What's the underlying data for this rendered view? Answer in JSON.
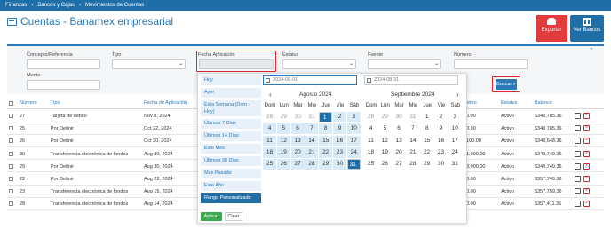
{
  "breadcrumb": [
    "Finanzas",
    "Bancos y Cajas",
    "Movimientos de Cuentas"
  ],
  "page_title": "Cuentas - Banamex empresarial",
  "buttons": {
    "exportar": "Exportar",
    "ver_bancos": "Ver Bancos",
    "buscar": "Buscar",
    "aplicar": "Aplicar",
    "clear": "Clear"
  },
  "filters": {
    "concepto_label": "Concepto/Referencia",
    "tipo_label": "Tipo",
    "fecha_label": "Fecha Aplicación",
    "estatus_label": "Estatus",
    "fuente_label": "Fuente",
    "numero_label": "Número",
    "monto_label": "Monto"
  },
  "date_range": {
    "options": [
      "Hoy",
      "Ayer",
      "Esta Semana (Dom - Hoy)",
      "Últimos 7 Días",
      "Últimos 14 Días",
      "Este Mes",
      "Últimos 30 Días",
      "Mes Pasado",
      "Este Año",
      "Rango Personalizado"
    ],
    "active": "Rango Personalizado",
    "start": "2024-08-01",
    "end": "2024-08-31",
    "weekdays": [
      "Dom",
      "Lun",
      "Mar",
      "Mie",
      "Jue",
      "Vie",
      "Sáb"
    ],
    "months": [
      {
        "name": "Agosto 2024",
        "days": [
          [
            "28",
            "29",
            "30",
            "31",
            "1",
            "2",
            "3"
          ],
          [
            "4",
            "5",
            "6",
            "7",
            "8",
            "9",
            "10"
          ],
          [
            "11",
            "12",
            "13",
            "14",
            "15",
            "16",
            "17"
          ],
          [
            "18",
            "19",
            "20",
            "21",
            "22",
            "23",
            "24"
          ],
          [
            "25",
            "26",
            "27",
            "28",
            "29",
            "30",
            "31"
          ]
        ]
      },
      {
        "name": "Septiembre 2024",
        "days": [
          [
            "28",
            "29",
            "30",
            "31",
            "1",
            "2",
            "3"
          ],
          [
            "4",
            "5",
            "6",
            "7",
            "8",
            "9",
            "10"
          ],
          [
            "11",
            "12",
            "13",
            "14",
            "15",
            "16",
            "17"
          ],
          [
            "18",
            "19",
            "20",
            "21",
            "22",
            "23",
            "24"
          ],
          [
            "25",
            "26",
            "27",
            "28",
            "29",
            "30",
            "31"
          ]
        ]
      }
    ]
  },
  "table": {
    "headers": {
      "numero": "Número",
      "tipo": "Tipo",
      "fecha": "Fecha de Aplicación",
      "retiro": "Retiro",
      "estatus": "Estatus",
      "balance": "Balance"
    },
    "rows": [
      {
        "numero": "27",
        "tipo": "Tarjeta de débito",
        "fecha": "Nov 8, 2024",
        "retiro": "$0.00",
        "estatus": "Activo",
        "balance": "$348,785.36"
      },
      {
        "numero": "25",
        "tipo": "Por Definir",
        "fecha": "Oct 22, 2024",
        "retiro": "$0.00",
        "estatus": "Activo",
        "balance": "$348,785.36"
      },
      {
        "numero": "26",
        "tipo": "Por Definir",
        "fecha": "Oct 20, 2024",
        "retiro": "$100.00",
        "estatus": "Activo",
        "balance": "$348,648.36"
      },
      {
        "numero": "30",
        "tipo": "Transferencia electrónica de fondos",
        "fecha": "Aug 30, 2024",
        "retiro": "$1,000.00",
        "estatus": "Activo",
        "balance": "$348,749.36"
      },
      {
        "numero": "29",
        "tipo": "Por Definir",
        "fecha": "Aug 30, 2024",
        "retiro": "$8,000.00",
        "estatus": "Activo",
        "balance": "$349,749.36"
      },
      {
        "numero": "22",
        "tipo": "Por Definir",
        "fecha": "Aug 22, 2024",
        "retiro": "$0.00",
        "estatus": "Activo",
        "balance": "$357,749.36"
      },
      {
        "numero": "23",
        "tipo": "Transferencia electrónica de fondos",
        "fecha": "Aug 15, 2024",
        "retiro": "$0.00",
        "estatus": "Activo",
        "balance": "$357,759.36"
      },
      {
        "numero": "28",
        "tipo": "Transferencia electrónica de fondos",
        "fecha": "Aug 14, 2024",
        "retiro": "$0.00",
        "estatus": "Activo",
        "balance": "$357,411.36"
      }
    ]
  },
  "colors": {
    "primary": "#1f6ea8",
    "danger": "#e23b3b",
    "success": "#3eaa4f",
    "highlight": "#d8272d"
  }
}
